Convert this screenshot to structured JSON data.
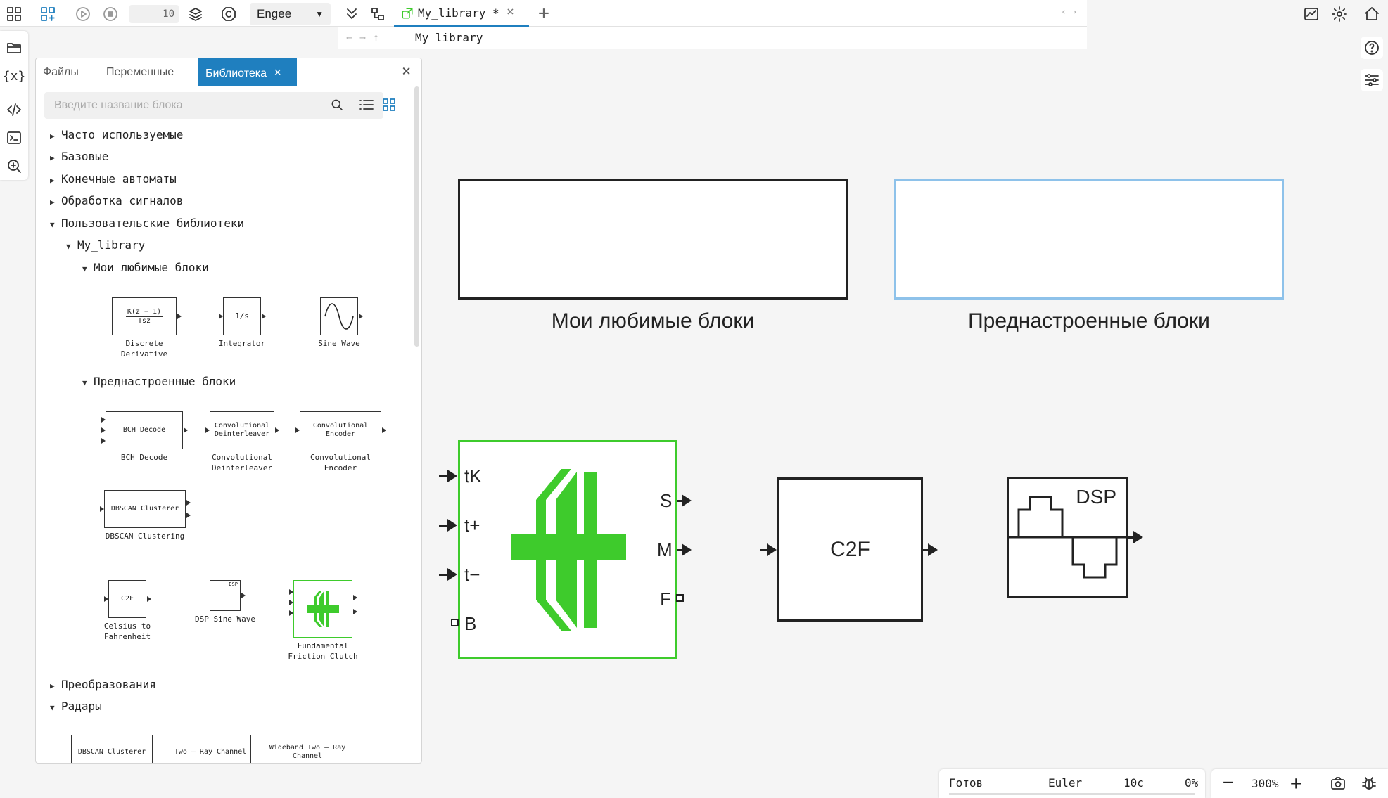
{
  "topbar": {
    "step_value": "10",
    "engine": "Engee",
    "tab_title": "My_library *",
    "breadcrumb": "My_library"
  },
  "panel": {
    "tabs": [
      "Файлы",
      "Переменные",
      "Библиотека"
    ],
    "search_placeholder": "Введите название блока",
    "tree": {
      "frequent": "Часто используемые",
      "basic": "Базовые",
      "fsm": "Конечные автоматы",
      "signal": "Обработка сигналов",
      "user_libs": "Пользовательские библиотеки",
      "my_library": "My_library",
      "favorites": "Мои любимые блоки",
      "preset": "Преднастроенные блоки",
      "transforms": "Преобразования",
      "radars": "Радары"
    },
    "blocks": {
      "discrete_derivative": {
        "icon_num": "K(z − 1)",
        "icon_den": "Tsz",
        "caption": "Discrete Derivative"
      },
      "integrator": {
        "icon": "1/s",
        "caption": "Integrator"
      },
      "sine_wave": {
        "caption": "Sine Wave"
      },
      "bch_decode": {
        "icon": "BCH Decode",
        "caption": "BCH Decode"
      },
      "conv_deinterleaver": {
        "icon": "Convolutional Deinterleaver",
        "caption": "Convolutional Deinterleaver"
      },
      "conv_encoder": {
        "icon": "Convolutional Encoder",
        "caption": "Convolutional Encoder"
      },
      "dbscan": {
        "icon": "DBSCAN Clusterer",
        "caption": "DBSCAN Clustering"
      },
      "c2f": {
        "icon": "C2F",
        "caption": "Celsius to Fahrenheit"
      },
      "dsp_sine": {
        "icon": "DSP",
        "caption": "DSP Sine Wave"
      },
      "friction_clutch": {
        "caption": "Fundamental Friction Clutch"
      },
      "radar_dbscan": {
        "icon": "DBSCAN Clusterer"
      },
      "two_ray": {
        "icon": "Two – Ray Channel"
      },
      "wideband": {
        "icon": "Wideband Two – Ray Channel"
      }
    }
  },
  "canvas": {
    "group1_label": "Мои любимые блоки",
    "group2_label": "Преднастроенные блоки",
    "clutch_ports": {
      "in": [
        "tK",
        "t+",
        "t−",
        "B"
      ],
      "out": [
        "S",
        "M",
        "F"
      ]
    },
    "c2f_label": "C2F",
    "dsp_label": "DSP"
  },
  "status": {
    "state": "Готов",
    "solver": "Euler",
    "time": "10с",
    "progress": "0%"
  },
  "zoom": {
    "level": "300%"
  },
  "colors": {
    "accent": "#1f7fbf",
    "clutch_green": "#3ecb2c",
    "selection": "#8ec2ea"
  }
}
